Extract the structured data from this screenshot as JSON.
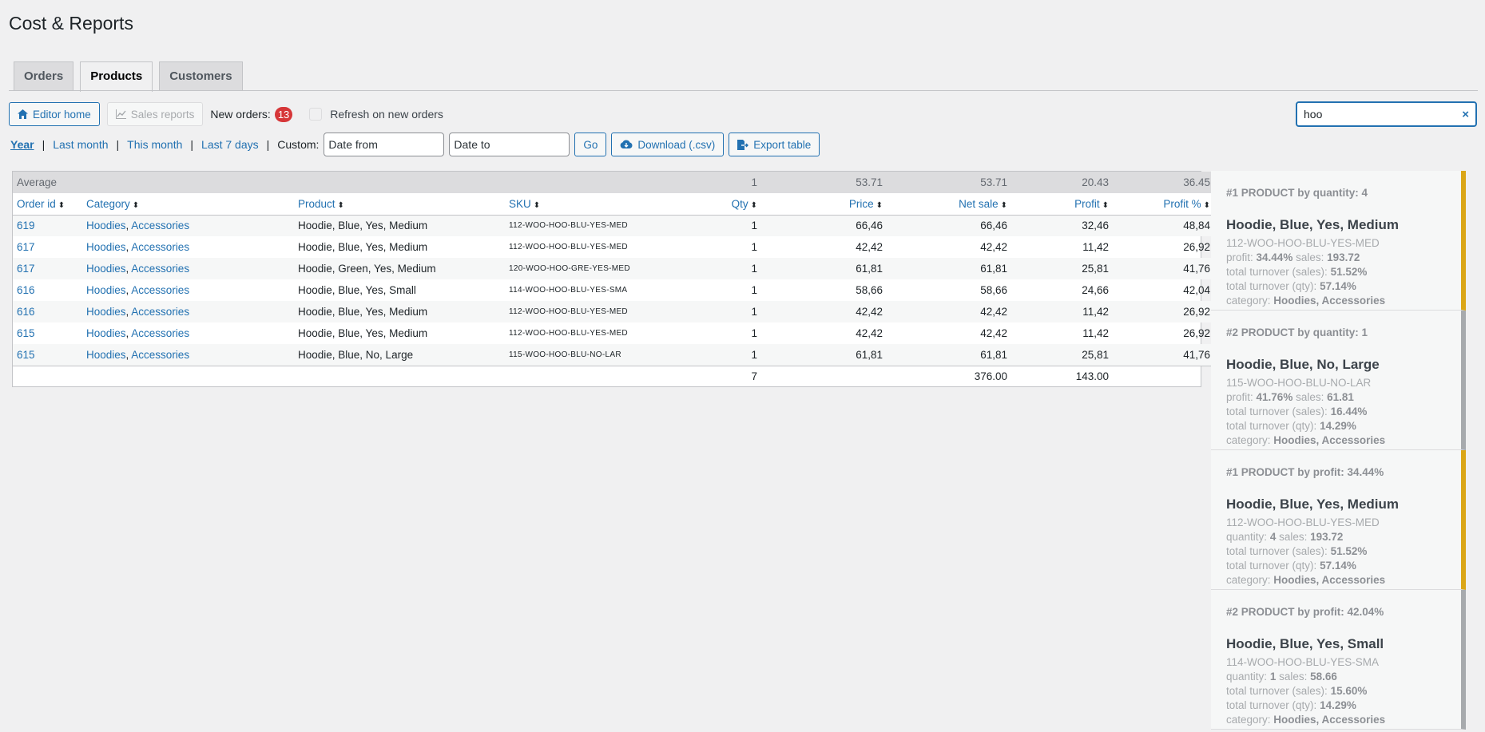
{
  "page_title": "Cost & Reports",
  "tabs": [
    {
      "label": "Orders",
      "active": false
    },
    {
      "label": "Products",
      "active": true
    },
    {
      "label": "Customers",
      "active": false
    }
  ],
  "toolbar": {
    "editor_home": "Editor home",
    "sales_reports": "Sales reports",
    "new_orders_label": "New orders:",
    "new_orders_count": "13",
    "refresh_label": "Refresh on new orders"
  },
  "search": {
    "value": "hoo",
    "clear": "×"
  },
  "periods": {
    "year": "Year",
    "last_month": "Last month",
    "this_month": "This month",
    "last_7_days": "Last 7 days",
    "custom": "Custom:",
    "date_from_placeholder": "Date from",
    "date_to_placeholder": "Date to",
    "go": "Go",
    "download": "Download (.csv)",
    "export": "Export table"
  },
  "table": {
    "average": {
      "label": "Average",
      "qty": "1",
      "price": "53.71",
      "net_sale": "53.71",
      "profit": "20.43",
      "profit_pct": "36.45"
    },
    "headers": {
      "order_id": "Order id",
      "category": "Category",
      "product": "Product",
      "sku": "SKU",
      "qty": "Qty",
      "price": "Price",
      "net_sale": "Net sale",
      "profit": "Profit",
      "profit_pct": "Profit %"
    },
    "rows": [
      {
        "order_id": "619",
        "cat1": "Hoodies",
        "cat2": "Accessories",
        "product": "Hoodie, Blue, Yes, Medium",
        "sku": "112-WOO-HOO-BLU-YES-MED",
        "qty": "1",
        "price": "66,46",
        "net_sale": "66,46",
        "profit": "32,46",
        "profit_pct": "48,84"
      },
      {
        "order_id": "617",
        "cat1": "Hoodies",
        "cat2": "Accessories",
        "product": "Hoodie, Blue, Yes, Medium",
        "sku": "112-WOO-HOO-BLU-YES-MED",
        "qty": "1",
        "price": "42,42",
        "net_sale": "42,42",
        "profit": "11,42",
        "profit_pct": "26,92"
      },
      {
        "order_id": "617",
        "cat1": "Hoodies",
        "cat2": "Accessories",
        "product": "Hoodie, Green, Yes, Medium",
        "sku": "120-WOO-HOO-GRE-YES-MED",
        "qty": "1",
        "price": "61,81",
        "net_sale": "61,81",
        "profit": "25,81",
        "profit_pct": "41,76"
      },
      {
        "order_id": "616",
        "cat1": "Hoodies",
        "cat2": "Accessories",
        "product": "Hoodie, Blue, Yes, Small",
        "sku": "114-WOO-HOO-BLU-YES-SMA",
        "qty": "1",
        "price": "58,66",
        "net_sale": "58,66",
        "profit": "24,66",
        "profit_pct": "42,04"
      },
      {
        "order_id": "616",
        "cat1": "Hoodies",
        "cat2": "Accessories",
        "product": "Hoodie, Blue, Yes, Medium",
        "sku": "112-WOO-HOO-BLU-YES-MED",
        "qty": "1",
        "price": "42,42",
        "net_sale": "42,42",
        "profit": "11,42",
        "profit_pct": "26,92"
      },
      {
        "order_id": "615",
        "cat1": "Hoodies",
        "cat2": "Accessories",
        "product": "Hoodie, Blue, Yes, Medium",
        "sku": "112-WOO-HOO-BLU-YES-MED",
        "qty": "1",
        "price": "42,42",
        "net_sale": "42,42",
        "profit": "11,42",
        "profit_pct": "26,92"
      },
      {
        "order_id": "615",
        "cat1": "Hoodies",
        "cat2": "Accessories",
        "product": "Hoodie, Blue, No, Large",
        "sku": "115-WOO-HOO-BLU-NO-LAR",
        "qty": "1",
        "price": "61,81",
        "net_sale": "61,81",
        "profit": "25,81",
        "profit_pct": "41,76"
      }
    ],
    "totals": {
      "qty": "7",
      "net_sale": "376.00",
      "profit": "143.00"
    }
  },
  "cards": [
    {
      "kicker": "#1 PRODUCT by quantity: 4",
      "name": "Hoodie, Blue, Yes, Medium",
      "sku": "112-WOO-HOO-BLU-YES-MED",
      "m1_label": "profit:",
      "m1_value": "34.44%",
      "m2_label": "sales:",
      "m2_value": "193.72",
      "ts_label": "total turnover (sales):",
      "ts_value": "51.52%",
      "tq_label": "total turnover (qty):",
      "tq_value": "57.14%",
      "cat_label": "category:",
      "cat_value": "Hoodies, Accessories",
      "accent": "#dba617"
    },
    {
      "kicker": "#2 PRODUCT by quantity: 1",
      "name": "Hoodie, Blue, No, Large",
      "sku": "115-WOO-HOO-BLU-NO-LAR",
      "m1_label": "profit:",
      "m1_value": "41.76%",
      "m2_label": "sales:",
      "m2_value": "61.81",
      "ts_label": "total turnover (sales):",
      "ts_value": "16.44%",
      "tq_label": "total turnover (qty):",
      "tq_value": "14.29%",
      "cat_label": "category:",
      "cat_value": "Hoodies, Accessories",
      "accent": "#a7aaad"
    },
    {
      "kicker": "#1 PRODUCT by profit: 34.44%",
      "name": "Hoodie, Blue, Yes, Medium",
      "sku": "112-WOO-HOO-BLU-YES-MED",
      "m1_label": "quantity:",
      "m1_value": "4",
      "m2_label": "sales:",
      "m2_value": "193.72",
      "ts_label": "total turnover (sales):",
      "ts_value": "51.52%",
      "tq_label": "total turnover (qty):",
      "tq_value": "57.14%",
      "cat_label": "category:",
      "cat_value": "Hoodies, Accessories",
      "accent": "#dba617"
    },
    {
      "kicker": "#2 PRODUCT by profit: 42.04%",
      "name": "Hoodie, Blue, Yes, Small",
      "sku": "114-WOO-HOO-BLU-YES-SMA",
      "m1_label": "quantity:",
      "m1_value": "1",
      "m2_label": "sales:",
      "m2_value": "58.66",
      "ts_label": "total turnover (sales):",
      "ts_value": "15.60%",
      "tq_label": "total turnover (qty):",
      "tq_value": "14.29%",
      "cat_label": "category:",
      "cat_value": "Hoodies, Accessories",
      "accent": "#a7aaad"
    }
  ],
  "colors": {
    "link": "#2271b1",
    "badge": "#d63638",
    "gold_accent": "#dba617",
    "grey_accent": "#a7aaad"
  },
  "icons": {
    "home": "home-icon",
    "chart": "chart-line-icon",
    "download": "cloud-download-icon",
    "export": "file-export-icon",
    "sort": "sort-icon"
  }
}
